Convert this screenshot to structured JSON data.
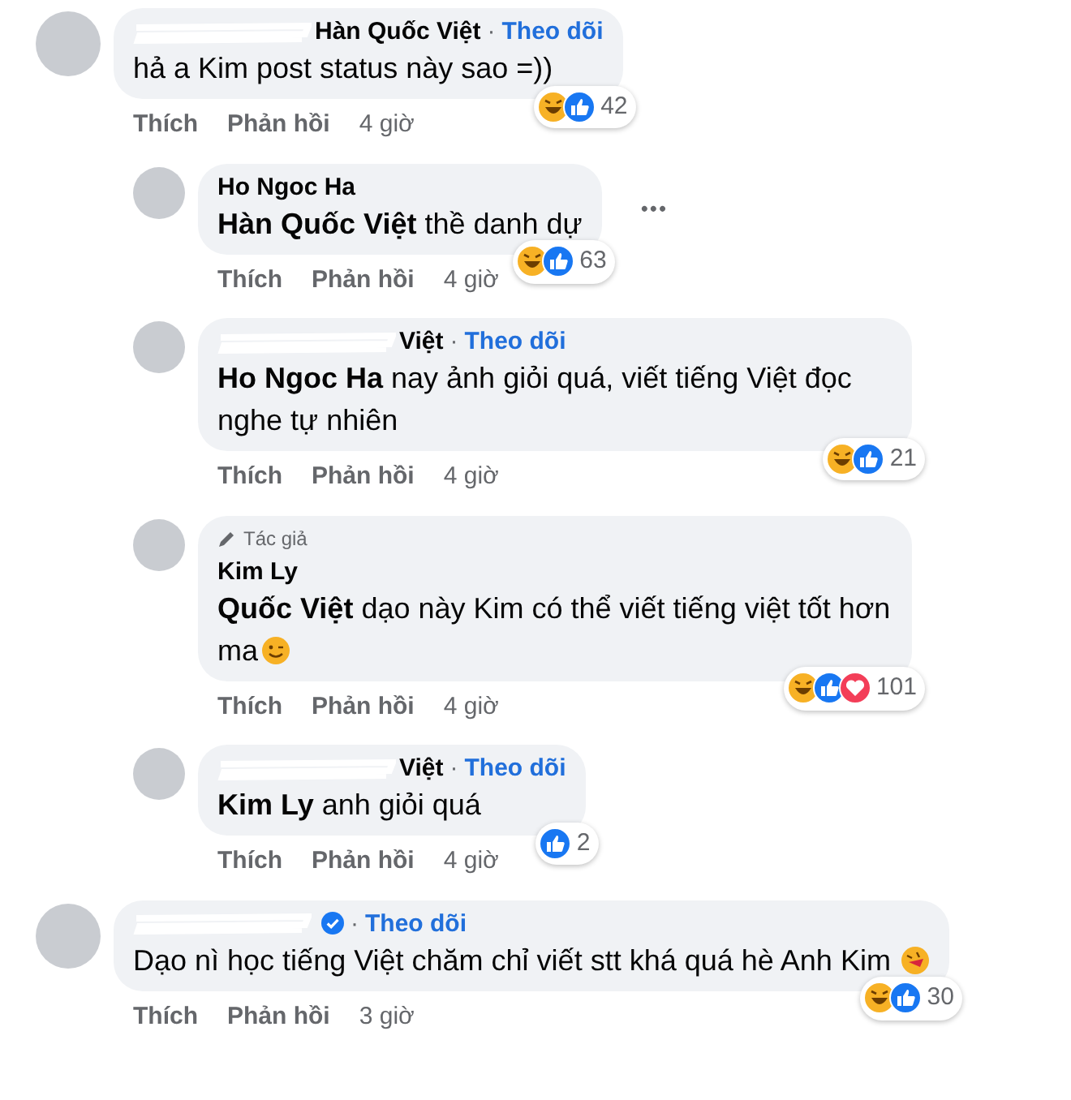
{
  "comments": [
    {
      "reply": false,
      "redacted": true,
      "author": "Hàn Quốc Việt",
      "dot": "·",
      "follow": "Theo dõi",
      "text": "hả a Kim post status này sao =))",
      "reactions": [
        {
          "kind": "haha"
        },
        {
          "kind": "like"
        }
      ],
      "count": "42",
      "actions": [
        "Thích",
        "Phản hồi"
      ],
      "time": "4 giờ"
    },
    {
      "reply": true,
      "author": "Ho Ngoc Ha",
      "text": "**Hàn Quốc Việt** thề danh dự",
      "more": "•••",
      "reactions": [
        {
          "kind": "haha"
        },
        {
          "kind": "like"
        }
      ],
      "count": "63",
      "actions": [
        "Thích",
        "Phản hồi"
      ],
      "time": "4 giờ"
    },
    {
      "reply": true,
      "redacted": true,
      "author": "Việt",
      "dot": "·",
      "follow": "Theo dõi",
      "text": "**Ho Ngoc Ha** nay ảnh giỏi quá, viết tiếng Việt đọc nghe tự nhiên",
      "reactions": [
        {
          "kind": "haha"
        },
        {
          "kind": "like"
        }
      ],
      "count": "21",
      "actions": [
        "Thích",
        "Phản hồi"
      ],
      "time": "4 giờ"
    },
    {
      "reply": true,
      "badge": "Tác giả",
      "author": "Kim Ly",
      "text": "**Quốc Việt** dạo này Kim có thể viết tiếng việt tốt hơn ma",
      "emoji": {
        "kind": "wink"
      },
      "reactions": [
        {
          "kind": "haha"
        },
        {
          "kind": "like"
        },
        {
          "kind": "love"
        }
      ],
      "count": "101",
      "actions": [
        "Thích",
        "Phản hồi"
      ],
      "time": "4 giờ"
    },
    {
      "reply": true,
      "redacted": true,
      "author": "Việt",
      "dot": "·",
      "follow": "Theo dõi",
      "text": "**Kim Ly** anh giỏi quá",
      "reactions": [
        {
          "kind": "like"
        }
      ],
      "count": "2",
      "actions": [
        "Thích",
        "Phản hồi"
      ],
      "time": "4 giờ"
    },
    {
      "reply": false,
      "redacted": true,
      "verified": true,
      "dot": "·",
      "follow": "Theo dõi",
      "text": "Dạo nì học tiếng Việt chăm chỉ viết stt khá quá hè Anh Kim",
      "emoji": {
        "kind": "laugh"
      },
      "reactions": [
        {
          "kind": "haha"
        },
        {
          "kind": "like"
        }
      ],
      "count": "30",
      "actions": [
        "Thích",
        "Phản hồi"
      ],
      "time": "3 giờ"
    }
  ]
}
